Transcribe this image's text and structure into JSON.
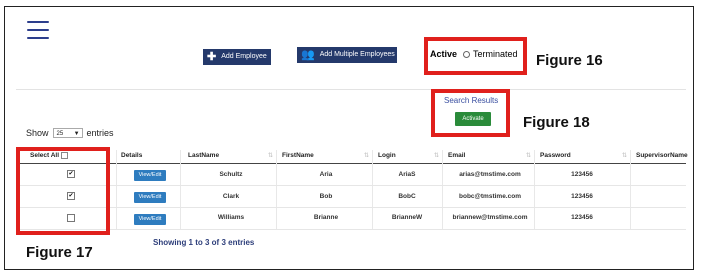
{
  "toolbar": {
    "add_employee_label": "Add Employee",
    "add_multiple_label": "Add Multiple Employees",
    "add_employee_icon": "plus-icon",
    "add_multiple_icon": "users-icon"
  },
  "status_filter": {
    "active_label": "Active",
    "terminated_label": "Terminated"
  },
  "figures": {
    "fig16": "Figure 16",
    "fig17": "Figure 17",
    "fig18": "Figure 18"
  },
  "search": {
    "results_label": "Search Results",
    "activate_label": "Activate"
  },
  "entries": {
    "show_label": "Show",
    "page_size": "25",
    "entries_label": "entries"
  },
  "table": {
    "headers": {
      "select_all": "Select All",
      "details": "Details",
      "lastname": "LastName",
      "firstname": "FirstName",
      "login": "Login",
      "email": "Email",
      "password": "Password",
      "supervisor": "SupervisorName"
    },
    "view_edit_label": "View/Edit",
    "rows": [
      {
        "checked": "✔",
        "lastname": "Schultz",
        "firstname": "Aria",
        "login": "AriaS",
        "email": "arias@tmstime.com",
        "password": "123456"
      },
      {
        "checked": "✔",
        "lastname": "Clark",
        "firstname": "Bob",
        "login": "BobC",
        "email": "bobc@tmstime.com",
        "password": "123456"
      },
      {
        "checked": "",
        "lastname": "Williams",
        "firstname": "Brianne",
        "login": "BrianneW",
        "email": "briannew@tmstime.com",
        "password": "123456"
      }
    ]
  },
  "footer": {
    "showing_text": "Showing 1 to 3 of 3 entries"
  },
  "colors": {
    "accent_red": "#e0201c",
    "navy": "#24396b",
    "activate_green": "#2a8b3a",
    "view_blue": "#2e7cbf"
  }
}
